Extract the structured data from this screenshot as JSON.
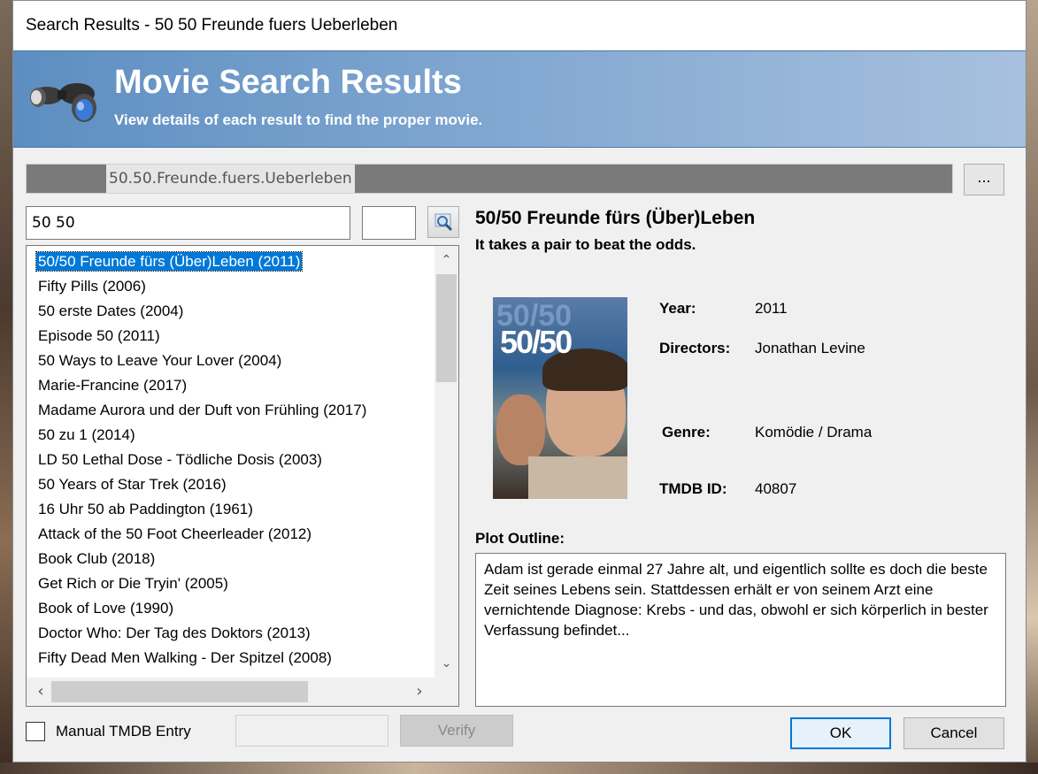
{
  "window": {
    "title": "Search Results - 50 50 Freunde fuers Ueberleben"
  },
  "header": {
    "title": "Movie Search Results",
    "subtitle": "View details of each result to find the proper movie.",
    "icon": "binoculars-icon"
  },
  "path": {
    "value": "50.50.Freunde.fuers.Ueberleben",
    "browse_label": "..."
  },
  "search": {
    "query": "50 50",
    "year": ""
  },
  "results": [
    {
      "label": "50/50 Freunde fürs (Über)Leben (2011)",
      "selected": true
    },
    {
      "label": "Fifty Pills (2006)"
    },
    {
      "label": "50 erste Dates (2004)"
    },
    {
      "label": "Episode 50 (2011)"
    },
    {
      "label": "50 Ways to Leave Your Lover (2004)"
    },
    {
      "label": "Marie-Francine (2017)"
    },
    {
      "label": "Madame Aurora und der Duft von Frühling (2017)"
    },
    {
      "label": "50 zu 1 (2014)"
    },
    {
      "label": "LD 50 Lethal Dose - Tödliche Dosis (2003)"
    },
    {
      "label": "50 Years of Star Trek (2016)"
    },
    {
      "label": "16 Uhr 50 ab Paddington (1961)"
    },
    {
      "label": "Attack of the 50 Foot Cheerleader (2012)"
    },
    {
      "label": "Book Club (2018)"
    },
    {
      "label": "Get Rich or Die Tryin' (2005)"
    },
    {
      "label": "Book of Love (1990)"
    },
    {
      "label": "Doctor Who: Der Tag des Doktors (2013)"
    },
    {
      "label": "Fifty Dead Men Walking - Der Spitzel (2008)"
    }
  ],
  "details": {
    "title": "50/50 Freunde fürs (Über)Leben",
    "tagline": "It takes a pair to beat the odds.",
    "poster_text": "50/50",
    "year_label": "Year:",
    "year": "2011",
    "directors_label": "Directors:",
    "directors": "Jonathan Levine",
    "genre_label": "Genre:",
    "genre": "Komödie / Drama",
    "tmdb_label": "TMDB ID:",
    "tmdb_id": "40807",
    "plot_label": "Plot Outline:",
    "plot": "Adam ist gerade einmal 27 Jahre alt, und eigentlich sollte es doch die beste Zeit seines Lebens sein. Stattdessen erhält er von seinem Arzt eine vernichtende Diagnose: Krebs - und das, obwohl er sich körperlich in bester Verfassung befindet..."
  },
  "footer": {
    "manual_label": "Manual TMDB Entry",
    "manual_checked": false,
    "tmdb_entry": "",
    "verify_label": "Verify",
    "ok_label": "OK",
    "cancel_label": "Cancel"
  },
  "colors": {
    "header_start": "#5d8ec1",
    "header_end": "#a7c0de",
    "selection": "#0078d7"
  }
}
